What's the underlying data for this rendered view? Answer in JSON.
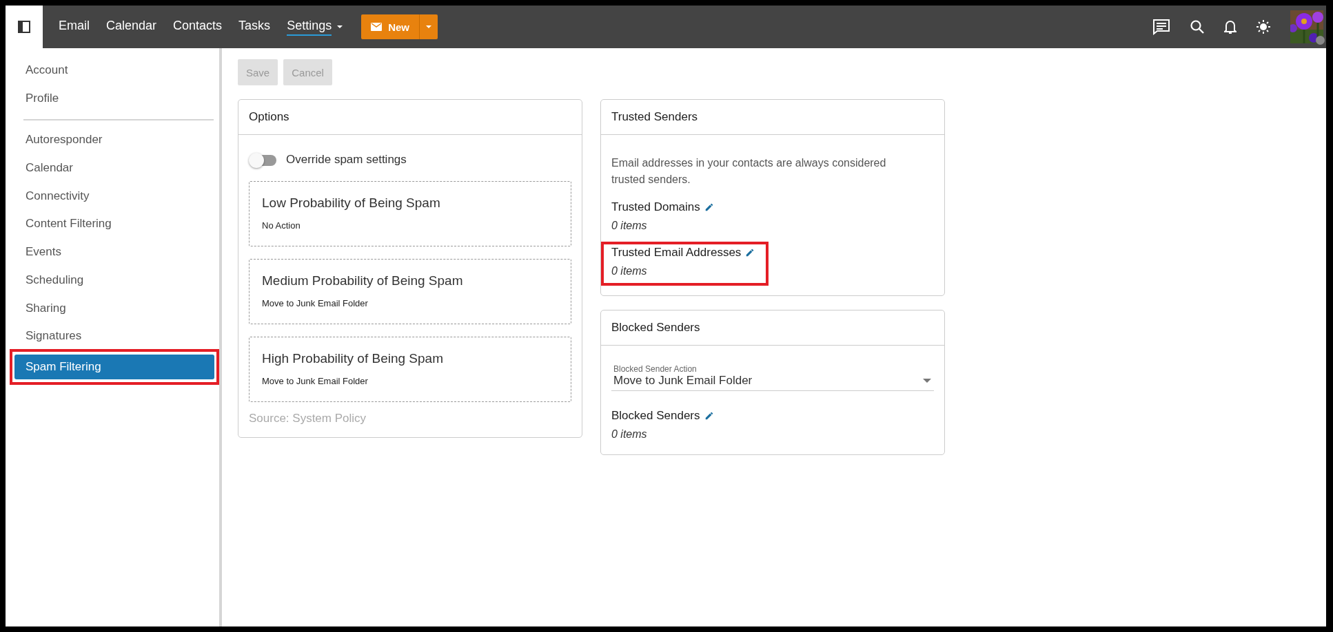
{
  "topbar": {
    "nav": [
      {
        "label": "Email",
        "selected": false,
        "dropdown": false
      },
      {
        "label": "Calendar",
        "selected": false,
        "dropdown": false
      },
      {
        "label": "Contacts",
        "selected": false,
        "dropdown": false
      },
      {
        "label": "Tasks",
        "selected": false,
        "dropdown": false
      },
      {
        "label": "Settings",
        "selected": true,
        "dropdown": true
      }
    ],
    "new_button": {
      "label": "New"
    }
  },
  "sidebar": {
    "groups": [
      [
        {
          "label": "Account",
          "selected": false,
          "highlighted": false
        },
        {
          "label": "Profile",
          "selected": false,
          "highlighted": false
        }
      ],
      [
        {
          "label": "Autoresponder",
          "selected": false,
          "highlighted": false
        },
        {
          "label": "Calendar",
          "selected": false,
          "highlighted": false
        },
        {
          "label": "Connectivity",
          "selected": false,
          "highlighted": false
        },
        {
          "label": "Content Filtering",
          "selected": false,
          "highlighted": false
        },
        {
          "label": "Events",
          "selected": false,
          "highlighted": false
        },
        {
          "label": "Scheduling",
          "selected": false,
          "highlighted": false
        },
        {
          "label": "Sharing",
          "selected": false,
          "highlighted": false
        },
        {
          "label": "Signatures",
          "selected": false,
          "highlighted": false
        },
        {
          "label": "Spam Filtering",
          "selected": true,
          "highlighted": true
        }
      ]
    ]
  },
  "actions": [
    {
      "label": "Save",
      "disabled": true
    },
    {
      "label": "Cancel",
      "disabled": true
    }
  ],
  "options": {
    "title": "Options",
    "toggle": {
      "label": "Override spam settings",
      "on": false
    },
    "levels": [
      {
        "title": "Low Probability of Being Spam",
        "action": "No Action"
      },
      {
        "title": "Medium Probability of Being Spam",
        "action": "Move to Junk Email Folder"
      },
      {
        "title": "High Probability of Being Spam",
        "action": "Move to Junk Email Folder"
      }
    ],
    "source": "Source: System Policy"
  },
  "trusted": {
    "title": "Trusted Senders",
    "note": "Email addresses in your contacts are always considered trusted senders.",
    "lists": [
      {
        "label": "Trusted Domains",
        "count": "0 items",
        "highlighted": false
      },
      {
        "label": "Trusted Email Addresses",
        "count": "0 items",
        "highlighted": true
      }
    ]
  },
  "blocked": {
    "title": "Blocked Senders",
    "select": {
      "label": "Blocked Sender Action",
      "value": "Move to Junk Email Folder"
    },
    "lists": [
      {
        "label": "Blocked Senders",
        "count": "0 items",
        "highlighted": false
      }
    ]
  }
}
